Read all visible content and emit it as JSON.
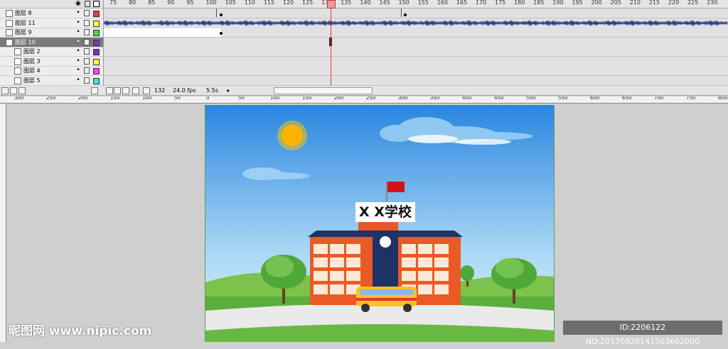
{
  "frame_ruler": [
    "75",
    "80",
    "85",
    "90",
    "95",
    "100",
    "105",
    "110",
    "115",
    "120",
    "125",
    "130",
    "135",
    "140",
    "145",
    "150",
    "155",
    "160",
    "165",
    "170",
    "175",
    "180",
    "185",
    "190",
    "195",
    "200",
    "205",
    "210",
    "215",
    "220",
    "225",
    "230"
  ],
  "layers": [
    {
      "name": "图层 8",
      "color": "#e84040",
      "selected": false,
      "type": "layer"
    },
    {
      "name": "图层 11",
      "color": "#ffff40",
      "selected": false,
      "type": "layer"
    },
    {
      "name": "图层 9",
      "color": "#40e040",
      "selected": false,
      "type": "layer"
    },
    {
      "name": "图层 10",
      "color": "#8030c0",
      "selected": true,
      "type": "folder"
    },
    {
      "name": "图层 2",
      "color": "#8030c0",
      "selected": false,
      "type": "sub"
    },
    {
      "name": "图层 3",
      "color": "#ffff40",
      "selected": false,
      "type": "sub"
    },
    {
      "name": "图层 4",
      "color": "#ff40ff",
      "selected": false,
      "type": "sub"
    },
    {
      "name": "图层 5",
      "color": "#40e0e0",
      "selected": false,
      "type": "sub"
    }
  ],
  "status": {
    "current_frame": "132",
    "fps": "24.0 fps",
    "time": "5.5s"
  },
  "h_ruler": [
    "300",
    "250",
    "200",
    "150",
    "100",
    "50",
    "0",
    "50",
    "100",
    "150",
    "200",
    "250",
    "300",
    "350",
    "400",
    "450",
    "500",
    "550",
    "600",
    "650",
    "700",
    "750",
    "800"
  ],
  "stage": {
    "school_sign": "X X学校"
  },
  "watermark_left": "昵图网 www.nipic.com",
  "watermark_right": "ID:2206122 NO:20170828141503662000"
}
